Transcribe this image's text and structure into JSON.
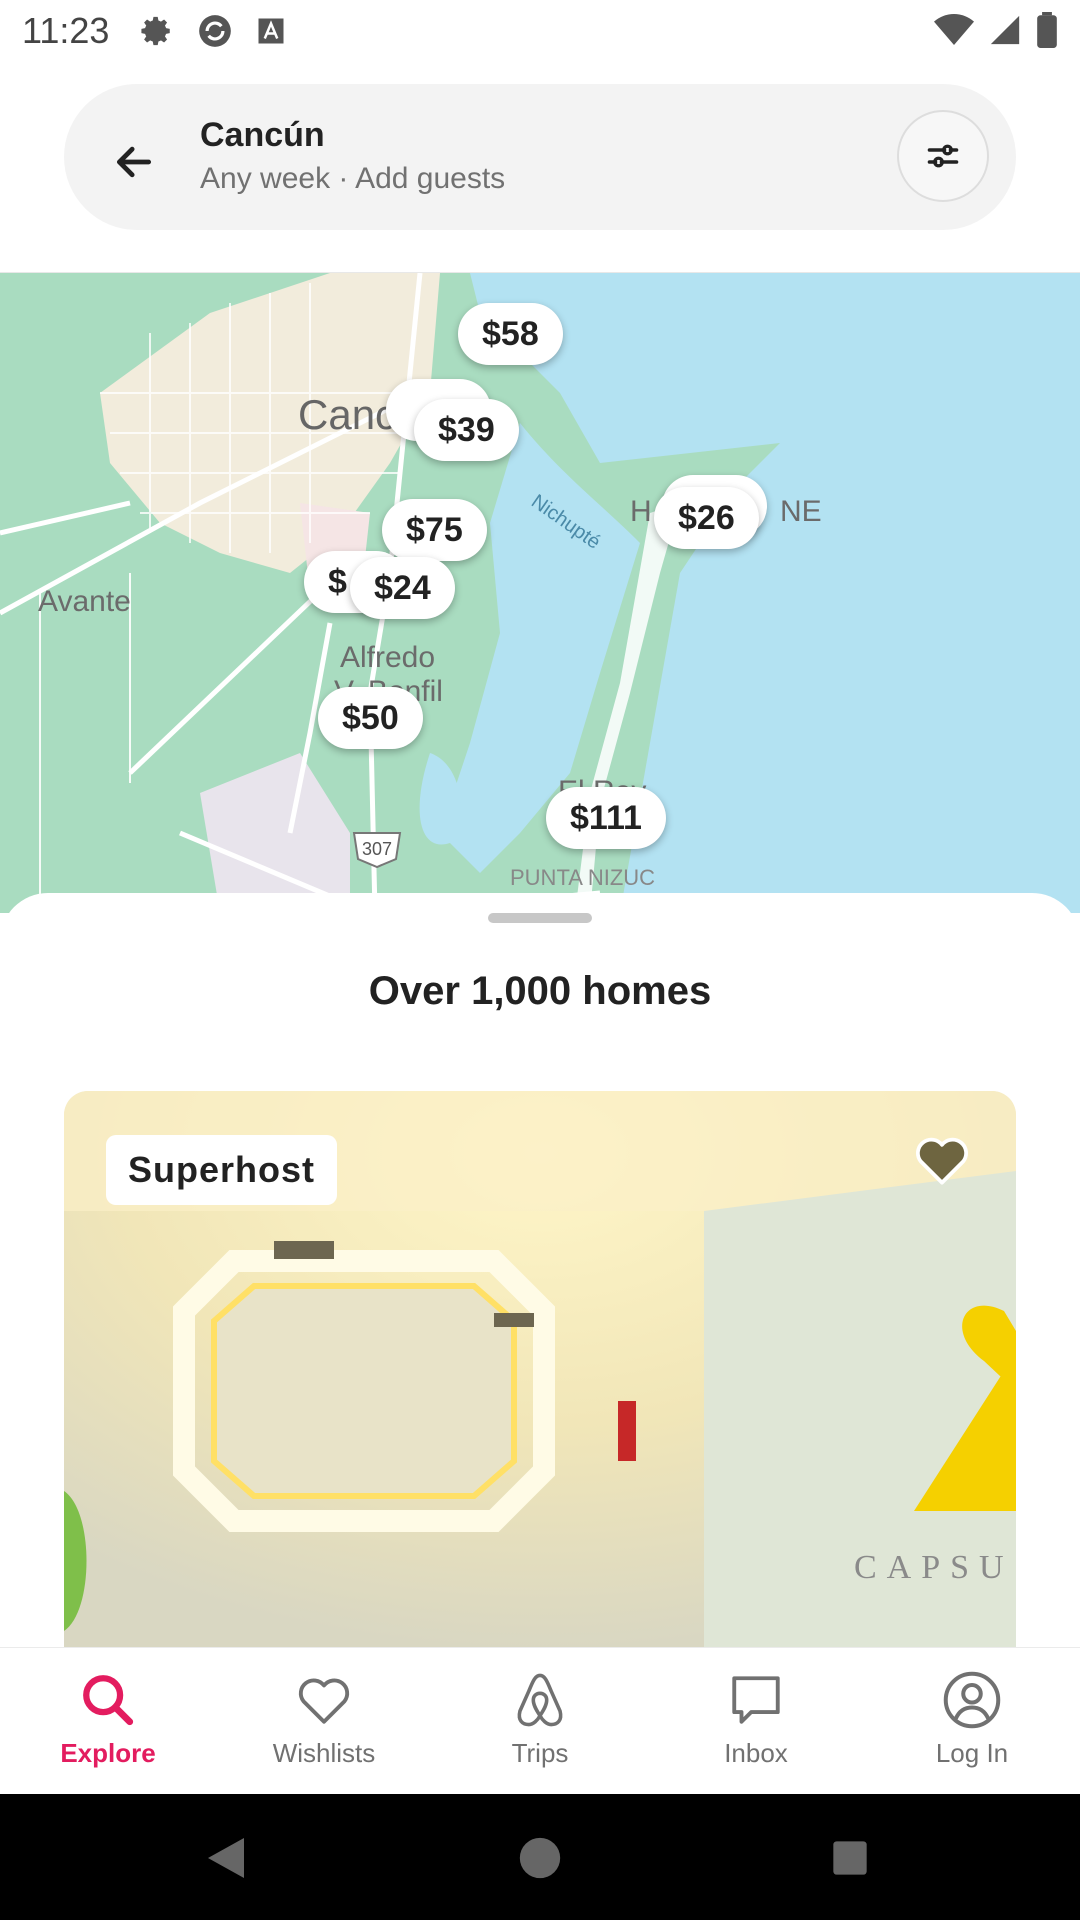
{
  "status_bar": {
    "time": "11:23",
    "left_icons": [
      "gear-icon",
      "sync-icon",
      "font-icon"
    ],
    "right_icons": [
      "wifi-icon",
      "signal-icon",
      "battery-icon"
    ]
  },
  "search": {
    "title": "Cancún",
    "subtitle": "Any week · Add guests",
    "back_icon": "arrow-left-icon",
    "filter_icon": "filter-sliders-icon"
  },
  "map": {
    "labels": [
      "Canc",
      "Avante",
      "Alfredo",
      "V. Bonfil",
      "Nichupté",
      "H",
      "NE",
      "El Rey",
      "PUNTA NIZUC"
    ],
    "road_shield": "307",
    "price_pins": [
      "$58",
      "$39",
      "$26",
      "$75",
      "$",
      "$24",
      "$50",
      "$111"
    ]
  },
  "sheet": {
    "title": "Over 1,000 homes",
    "listing": {
      "badge": "Superhost",
      "photo_text": "CAPSU"
    }
  },
  "bottom_nav": {
    "items": [
      {
        "label": "Explore",
        "icon": "search-icon",
        "active": true
      },
      {
        "label": "Wishlists",
        "icon": "heart-icon",
        "active": false
      },
      {
        "label": "Trips",
        "icon": "airbnb-logo-icon",
        "active": false
      },
      {
        "label": "Inbox",
        "icon": "message-icon",
        "active": false
      },
      {
        "label": "Log In",
        "icon": "user-circle-icon",
        "active": false
      }
    ]
  },
  "colors": {
    "accent": "#e31c5f",
    "map_water": "#b3e2f2",
    "map_land": "#a9dcc0",
    "text_primary": "#222222",
    "text_secondary": "#717171"
  }
}
